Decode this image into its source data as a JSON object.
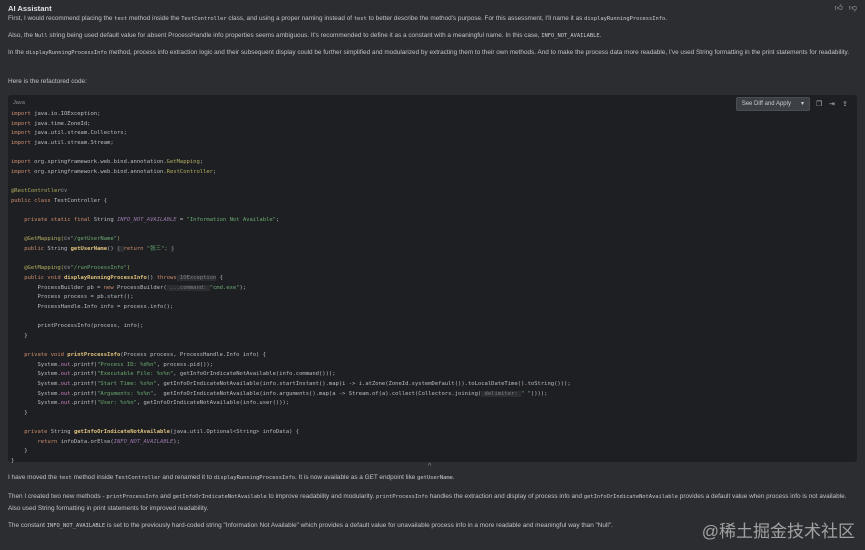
{
  "header": {
    "title": "AI Assistant",
    "icons": [
      "thumbs-up-icon",
      "thumbs-down-icon"
    ]
  },
  "intro": [
    [
      {
        "t": "First, I would recommend placing the "
      },
      {
        "c": "test"
      },
      {
        "t": " method inside the "
      },
      {
        "c": "TestController"
      },
      {
        "t": " class, and using a proper naming instead of "
      },
      {
        "c": "test"
      },
      {
        "t": " to better describe the method's purpose. For this assessment, I'll name it as "
      },
      {
        "c": "displayRunningProcessInfo"
      },
      {
        "t": "."
      }
    ],
    [
      {
        "t": "Also, the "
      },
      {
        "c": "Null"
      },
      {
        "t": " string being used default value for absent ProcessHandle info properties seems ambiguous. It's recommended to define it as a constant with a meaningful name. In this case, "
      },
      {
        "c": "INFO_NOT_AVAILABLE"
      },
      {
        "t": "."
      }
    ],
    [
      {
        "t": "In the "
      },
      {
        "c": "displayRunningProcessInfo"
      },
      {
        "t": " method, process info extraction logic and their subsequent display could be further simplified and modularized by extracting them to their own methods. And to make the process data more readable, I've used String formatting in the print statements for readability."
      }
    ],
    [
      {
        "t": "Here is the refactored code:"
      }
    ]
  ],
  "code_block": {
    "language": "Java",
    "apply_label": "See Diff and Apply",
    "tool_icons": [
      "copy-icon",
      "insert-icon",
      "export-icon"
    ],
    "lines": [
      [
        [
          "import",
          "kw"
        ],
        [
          " java.io.IOException;",
          "tx"
        ]
      ],
      [
        [
          "import",
          "kw"
        ],
        [
          " java.time.ZoneId;",
          "tx"
        ]
      ],
      [
        [
          "import",
          "kw"
        ],
        [
          " java.util.stream.Collectors;",
          "tx"
        ]
      ],
      [
        [
          "import",
          "kw"
        ],
        [
          " java.util.stream.Stream;",
          "tx"
        ]
      ],
      [],
      [
        [
          "import",
          "kw"
        ],
        [
          " org.springframework.web.bind.annotation.",
          "tx"
        ],
        [
          "GetMapping",
          "an"
        ],
        [
          ";",
          "tx"
        ]
      ],
      [
        [
          "import",
          "kw"
        ],
        [
          " org.springframework.web.bind.annotation.",
          "tx"
        ],
        [
          "RestController",
          "an"
        ],
        [
          ";",
          "tx"
        ]
      ],
      [],
      [
        [
          "@RestController",
          "an"
        ],
        [
          "©∨",
          "gl"
        ]
      ],
      [
        [
          "public class",
          "kw"
        ],
        [
          " TestController {",
          "tx"
        ]
      ],
      [],
      [
        [
          "    private static final",
          "kw"
        ],
        [
          " String ",
          "tx"
        ],
        [
          "INFO_NOT_AVAILABLE",
          "cn"
        ],
        [
          " = ",
          "tx"
        ],
        [
          "\"Information Not Available\"",
          "st"
        ],
        [
          ";",
          "tx"
        ]
      ],
      [],
      [
        [
          "    @GetMapping(",
          "an"
        ],
        [
          "©∨",
          "gl"
        ],
        [
          "\"/getUserName\"",
          "st"
        ],
        [
          ")",
          "an"
        ]
      ],
      [
        [
          "    public",
          "kw"
        ],
        [
          " String ",
          "tx"
        ],
        [
          "getUserName",
          "fn"
        ],
        [
          "() ",
          "tx"
        ],
        [
          "{ ",
          "hint"
        ],
        [
          "return",
          "kw"
        ],
        [
          " \"张三\"; ",
          "st"
        ],
        [
          "}",
          "hint"
        ]
      ],
      [],
      [
        [
          "    @GetMapping(",
          "an"
        ],
        [
          "©∨",
          "gl"
        ],
        [
          "\"/runProcessInfo\"",
          "st"
        ],
        [
          ")",
          "an"
        ]
      ],
      [
        [
          "    public void",
          "kw"
        ],
        [
          " ",
          "tx"
        ],
        [
          "displayRunningProcessInfo",
          "fn"
        ],
        [
          "() ",
          "tx"
        ],
        [
          "throws",
          "kw"
        ],
        [
          " IOException",
          "hint"
        ],
        [
          " {",
          "tx"
        ]
      ],
      [
        [
          "        ProcessBuilder pb = ",
          "tx"
        ],
        [
          "new",
          "kw"
        ],
        [
          " ProcessBuilder(",
          "tx"
        ],
        [
          " ...command: ",
          "hint"
        ],
        [
          "\"cmd.exe\"",
          "st"
        ],
        [
          ");",
          "tx"
        ]
      ],
      [
        [
          "        Process process = pb.start();",
          "tx"
        ]
      ],
      [
        [
          "        ProcessHandle.Info info = process.info();",
          "tx"
        ]
      ],
      [],
      [
        [
          "        printProcessInfo(process, info);",
          "tx"
        ]
      ],
      [
        [
          "    }",
          "tx"
        ]
      ],
      [],
      [
        [
          "    private void",
          "kw"
        ],
        [
          " ",
          "tx"
        ],
        [
          "printProcessInfo",
          "fn"
        ],
        [
          "(Process process, ProcessHandle.Info info) {",
          "tx"
        ]
      ],
      [
        [
          "        System.",
          "tx"
        ],
        [
          "out",
          "mb"
        ],
        [
          ".printf(",
          "tx"
        ],
        [
          "\"Process ID: %d%n\"",
          "st"
        ],
        [
          ", process.pid());",
          "tx"
        ]
      ],
      [
        [
          "        System.",
          "tx"
        ],
        [
          "out",
          "mb"
        ],
        [
          ".printf(",
          "tx"
        ],
        [
          "\"Executable File: %s%n\"",
          "st"
        ],
        [
          ", getInfoOrIndicateNotAvailable(info.command()));",
          "tx"
        ]
      ],
      [
        [
          "        System.",
          "tx"
        ],
        [
          "out",
          "mb"
        ],
        [
          ".printf(",
          "tx"
        ],
        [
          "\"Start Time: %s%n\"",
          "st"
        ],
        [
          ", getInfoOrIndicateNotAvailable(info.startInstant().map(i -> i.atZone(ZoneId.systemDefault()).toLocalDateTime().toString()));",
          "tx"
        ]
      ],
      [
        [
          "        System.",
          "tx"
        ],
        [
          "out",
          "mb"
        ],
        [
          ".printf(",
          "tx"
        ],
        [
          "\"Arguments: %s%n\"",
          "st"
        ],
        [
          ",  getInfoOrIndicateNotAvailable(info.arguments().map(a -> Stream.of(a).collect(Collectors.joining(",
          "tx"
        ],
        [
          " delimiter: ",
          "hint"
        ],
        [
          "\" \"",
          "st"
        ],
        [
          "))));",
          "tx"
        ]
      ],
      [
        [
          "        System.",
          "tx"
        ],
        [
          "out",
          "mb"
        ],
        [
          ".printf(",
          "tx"
        ],
        [
          "\"User: %s%n\"",
          "st"
        ],
        [
          ", getInfoOrIndicateNotAvailable(info.user()));",
          "tx"
        ]
      ],
      [
        [
          "    }",
          "tx"
        ]
      ],
      [],
      [
        [
          "    private",
          "kw"
        ],
        [
          " String ",
          "tx"
        ],
        [
          "getInfoOrIndicateNotAvailable",
          "fn"
        ],
        [
          "(java.util.Optional<String> infoData) {",
          "tx"
        ]
      ],
      [
        [
          "        return",
          "kw"
        ],
        [
          " infoData.orElse(",
          "tx"
        ],
        [
          "INFO_NOT_AVAILABLE",
          "cn"
        ],
        [
          ");",
          "tx"
        ]
      ],
      [
        [
          "    }",
          "tx"
        ]
      ],
      [
        [
          "}",
          "tx"
        ]
      ]
    ]
  },
  "outro": [
    [
      {
        "t": "I have moved the "
      },
      {
        "c": "test"
      },
      {
        "t": " method inside "
      },
      {
        "c": "TestController"
      },
      {
        "t": " and renamed it to "
      },
      {
        "c": "displayRunningProcessInfo"
      },
      {
        "t": ". It is now available as a GET endpoint like "
      },
      {
        "c": "getUserName"
      },
      {
        "t": "."
      }
    ],
    [
      {
        "t": "Then I created two new methods - "
      },
      {
        "c": "printProcessInfo"
      },
      {
        "t": " and "
      },
      {
        "c": "getInfoOrIndicateNotAvailable"
      },
      {
        "t": " to improve readability and modularity. "
      },
      {
        "c": "printProcessInfo"
      },
      {
        "t": " handles the extraction and display of process info and "
      },
      {
        "c": "getInfoOrIndicateNotAvailable"
      },
      {
        "t": " provides a default value when process info is not available. Also used String formatting in print statements for improved readability."
      }
    ],
    [
      {
        "t": "The constant "
      },
      {
        "c": "INFO_NOT_AVAILABLE"
      },
      {
        "t": " is set to the previously hard-coded string \"Information Not Available\" which provides a default value for unavailable process info in a more readable and meaningful way than \"Null\"."
      }
    ]
  ],
  "watermark": "@稀土掘金技术社区"
}
